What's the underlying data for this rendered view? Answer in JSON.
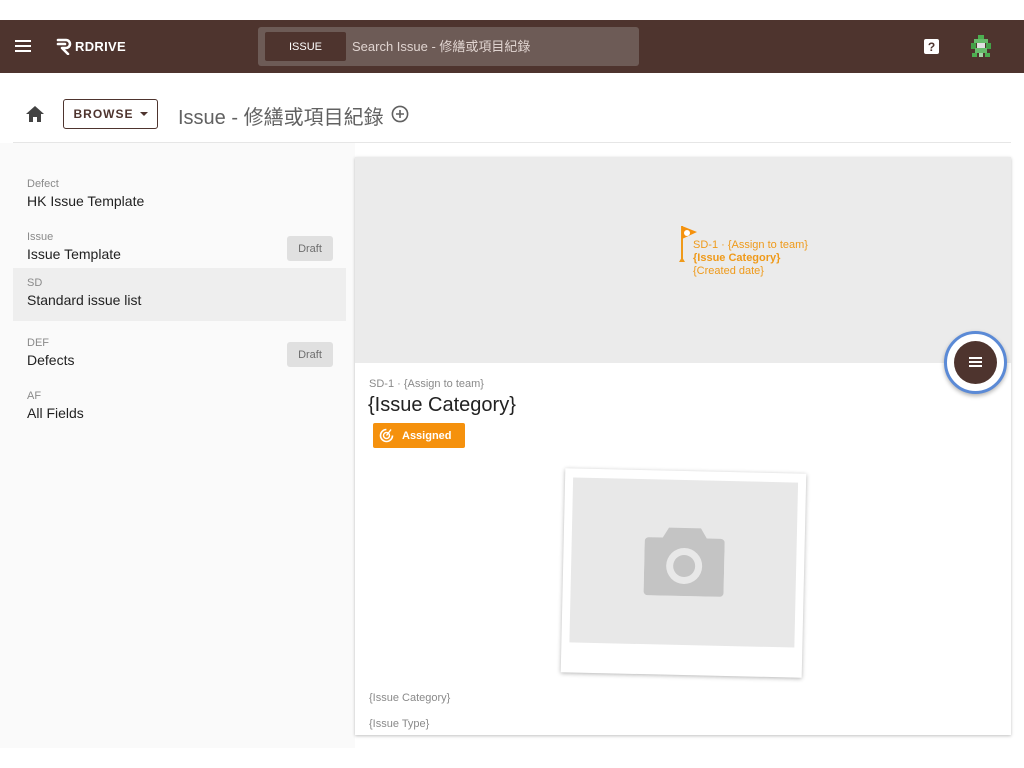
{
  "topbar": {
    "logo_text": "RDRIVE",
    "search": {
      "tab_label": "ISSUE",
      "placeholder": "Search Issue - 修繕或項目紀錄"
    },
    "help_label": "?"
  },
  "toolbar": {
    "browse_label": "BROWSE",
    "page_title": "Issue - 修繕或項目紀錄"
  },
  "templates": [
    {
      "code": "Defect",
      "name": "HK Issue Template",
      "badge": ""
    },
    {
      "code": "Issue",
      "name": "Issue Template",
      "badge": "Draft"
    },
    {
      "code": "SD",
      "name": "Standard issue list",
      "badge": "",
      "selected": true
    },
    {
      "code": "DEF",
      "name": "Defects",
      "badge": "Draft"
    },
    {
      "code": "AF",
      "name": "All Fields",
      "badge": ""
    }
  ],
  "preview": {
    "pin": {
      "meta": "SD-1 · {Assign to team}",
      "category": "{Issue Category}",
      "date": "{Created date}"
    },
    "meta": "SD-1 · {Assign to team}",
    "title": "{Issue Category}",
    "status": "Assigned",
    "fields": [
      "{Issue Category}",
      "{Issue Type}"
    ]
  },
  "colors": {
    "brand": "#4e342e",
    "status_assigned": "#f5910d",
    "pin": "#ef9a1a",
    "fab_ring": "#5b8ad6"
  }
}
